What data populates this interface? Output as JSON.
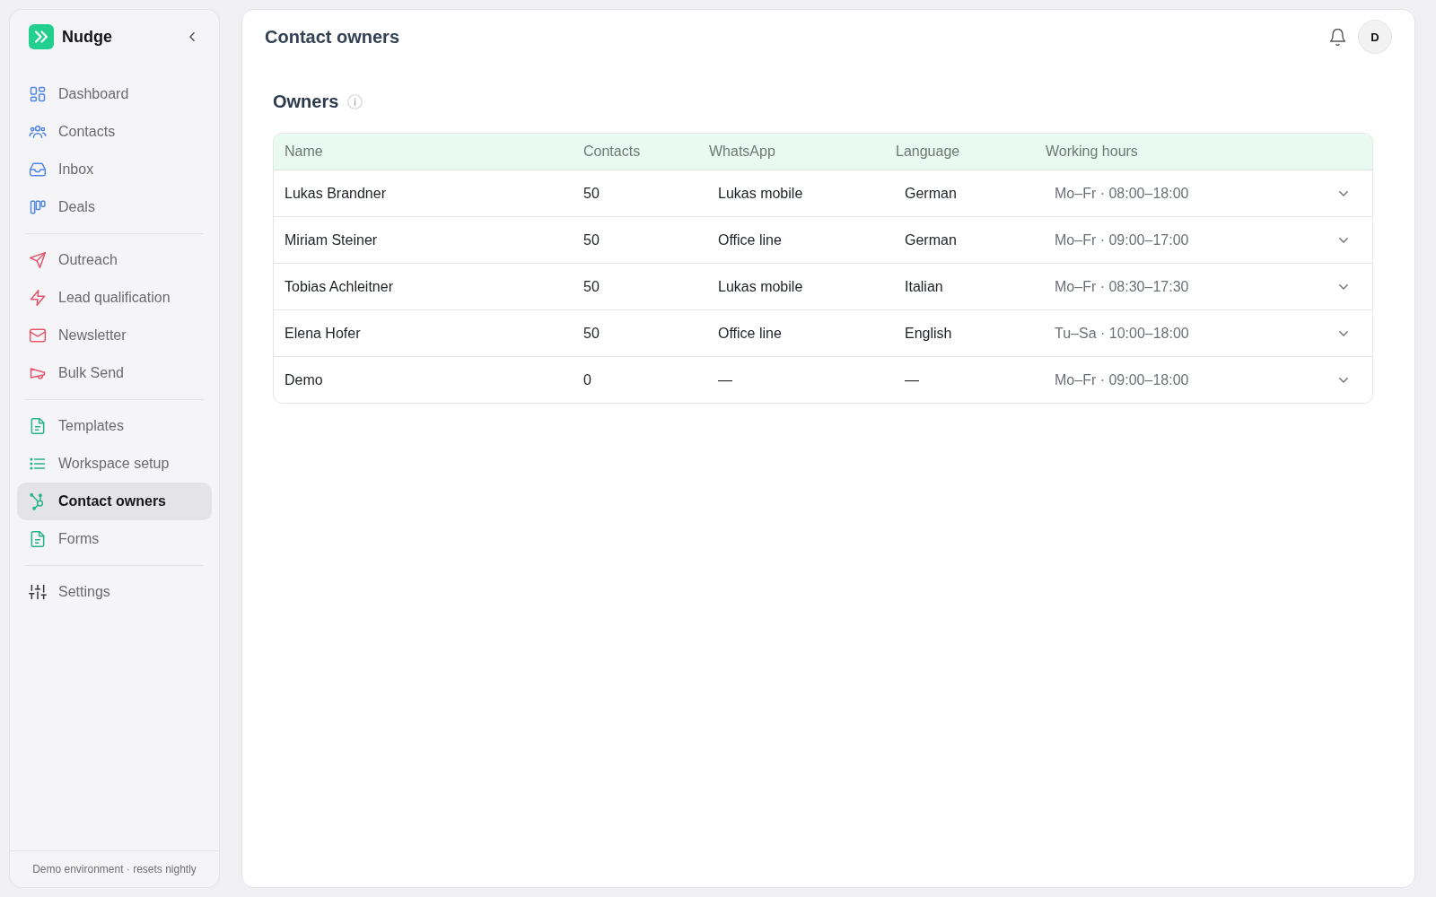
{
  "sidebar": {
    "brand": "Nudge",
    "sections": [
      {
        "color": "#4f86e8",
        "items": [
          {
            "label": "Dashboard",
            "selected": false
          },
          {
            "label": "Contacts",
            "selected": false
          },
          {
            "label": "Inbox",
            "selected": false
          },
          {
            "label": "Deals",
            "selected": false
          }
        ]
      },
      {
        "color": "#e4566c",
        "items": [
          {
            "label": "Outreach",
            "selected": false
          },
          {
            "label": "Lead qualification",
            "selected": false
          },
          {
            "label": "Newsletter",
            "selected": false
          },
          {
            "label": "Bulk Send",
            "selected": false
          }
        ]
      },
      {
        "color": "#27b386",
        "items": [
          {
            "label": "Templates",
            "selected": false
          },
          {
            "label": "Workspace setup",
            "selected": false
          },
          {
            "label": "Contact owners",
            "selected": true
          },
          {
            "label": "Forms",
            "selected": false
          }
        ]
      },
      {
        "color": "#35353a",
        "items": [
          {
            "label": "Settings",
            "selected": false
          }
        ]
      }
    ],
    "footer": "Demo environment · resets nightly"
  },
  "header": {
    "title": "Contact owners",
    "avatar": "D"
  },
  "owners": {
    "title": "Owners",
    "table": {
      "columns": [
        "Name",
        "Contacts",
        "WhatsApp",
        "Language",
        "Working hours"
      ],
      "rows": [
        {
          "name": "Lukas Brandner",
          "contacts": "50",
          "whatsapp": "Lukas mobile",
          "language": "German",
          "working_hours": "Mo–Fr · 08:00–18:00",
          "expanded": false
        },
        {
          "name": "Miriam Steiner",
          "contacts": "50",
          "whatsapp": "Office line",
          "language": "German",
          "working_hours": "Mo–Fr · 09:00–17:00",
          "expanded": false
        },
        {
          "name": "Tobias Achleitner",
          "contacts": "50",
          "whatsapp": "Lukas mobile",
          "language": "Italian",
          "working_hours": "Mo–Fr · 08:30–17:30",
          "expanded": false
        },
        {
          "name": "Elena Hofer",
          "contacts": "50",
          "whatsapp": "Office line",
          "language": "English",
          "working_hours": "Tu–Sa · 10:00–18:00",
          "expanded": false
        },
        {
          "name": "Demo",
          "contacts": "0",
          "whatsapp": "—",
          "language": "—",
          "working_hours": "Mo–Fr · 09:00–18:00",
          "expanded": false
        }
      ]
    }
  }
}
